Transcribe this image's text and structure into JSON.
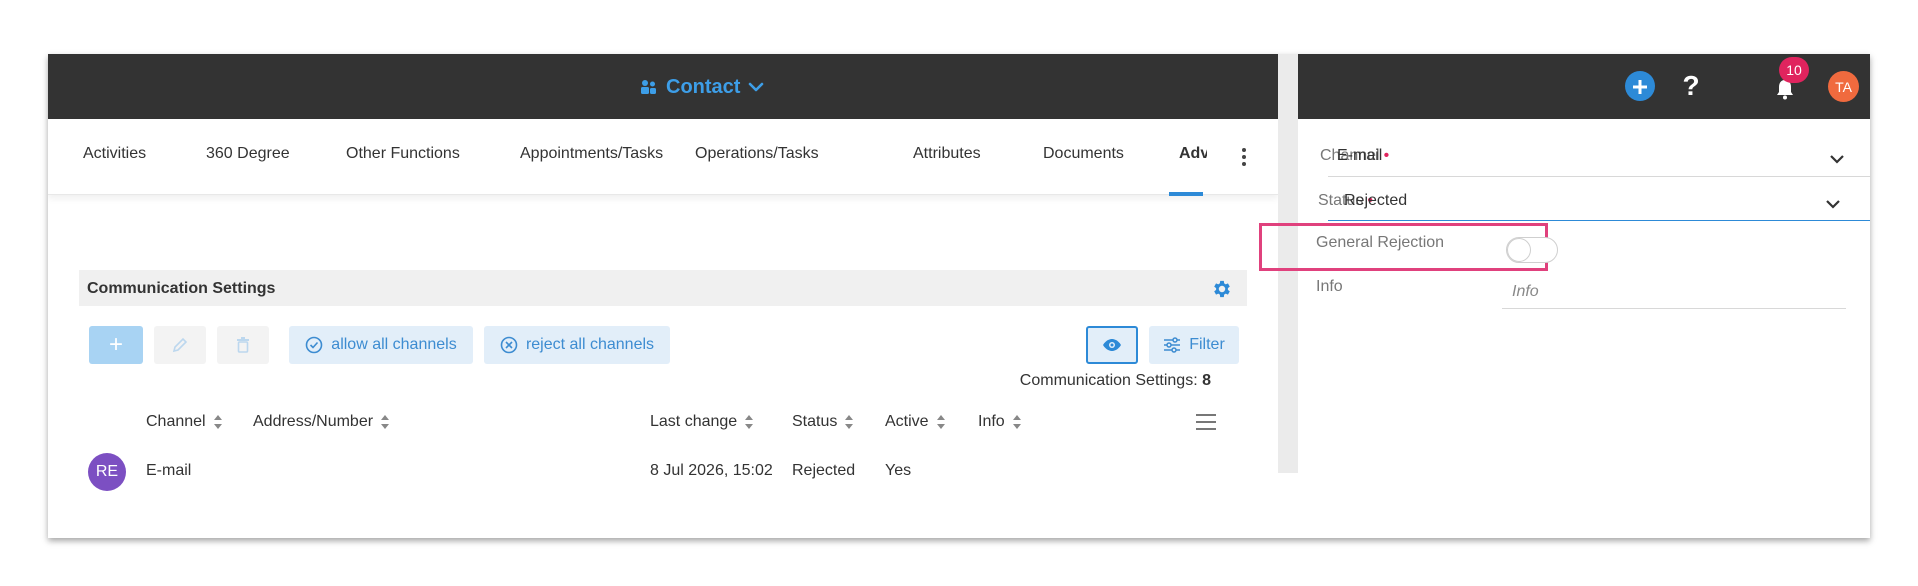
{
  "header": {
    "context_label": "Contact",
    "notification_count": "10",
    "user_initials": "TA",
    "help_label": "?"
  },
  "tabs": [
    {
      "label": "Activities"
    },
    {
      "label": "360 Degree"
    },
    {
      "label": "Other Functions"
    },
    {
      "label": "Appointments/Tasks"
    },
    {
      "label": "Operations/Tasks"
    },
    {
      "label": "Attributes"
    },
    {
      "label": "Documents"
    },
    {
      "label": "Adv"
    }
  ],
  "section": {
    "title": "Communication Settings"
  },
  "toolbar": {
    "add_label": "+",
    "allow_all_label": "allow all channels",
    "reject_all_label": "reject all channels",
    "filter_label": "Filter"
  },
  "summary": {
    "count_label": "Communication Settings:",
    "count_value": "8"
  },
  "table": {
    "columns": [
      "Channel",
      "Address/Number",
      "Last change",
      "Status",
      "Active",
      "Info"
    ],
    "rows": [
      {
        "initials": "RE",
        "channel": "E-mail",
        "address": "",
        "last_change": "8 Jul 2026, 15:02",
        "status": "Rejected",
        "active": "Yes",
        "info": ""
      }
    ]
  },
  "form": {
    "channel_label": "Channel",
    "channel_value": "E-mail",
    "status_label": "Status",
    "status_value": "Rejected",
    "general_rejection_label": "General Rejection",
    "info_label": "Info",
    "info_placeholder": "Info",
    "required_marker": "•"
  },
  "colors": {
    "topbar": "#333333",
    "accent": "#2d8ad7",
    "badge": "#e0245e",
    "highlight": "#e0417d",
    "row_avatar": "#7c4fc2",
    "user_avatar": "#f06a3e"
  },
  "icons": [
    "contacts-icon",
    "chevron-down-icon",
    "plus-icon",
    "help-icon",
    "bell-icon",
    "kebab-icon",
    "gear-icon",
    "pencil-icon",
    "trash-icon",
    "check-circle-icon",
    "x-circle-icon",
    "eye-icon",
    "filter-icon",
    "column-menu-icon",
    "sort-icon"
  ]
}
